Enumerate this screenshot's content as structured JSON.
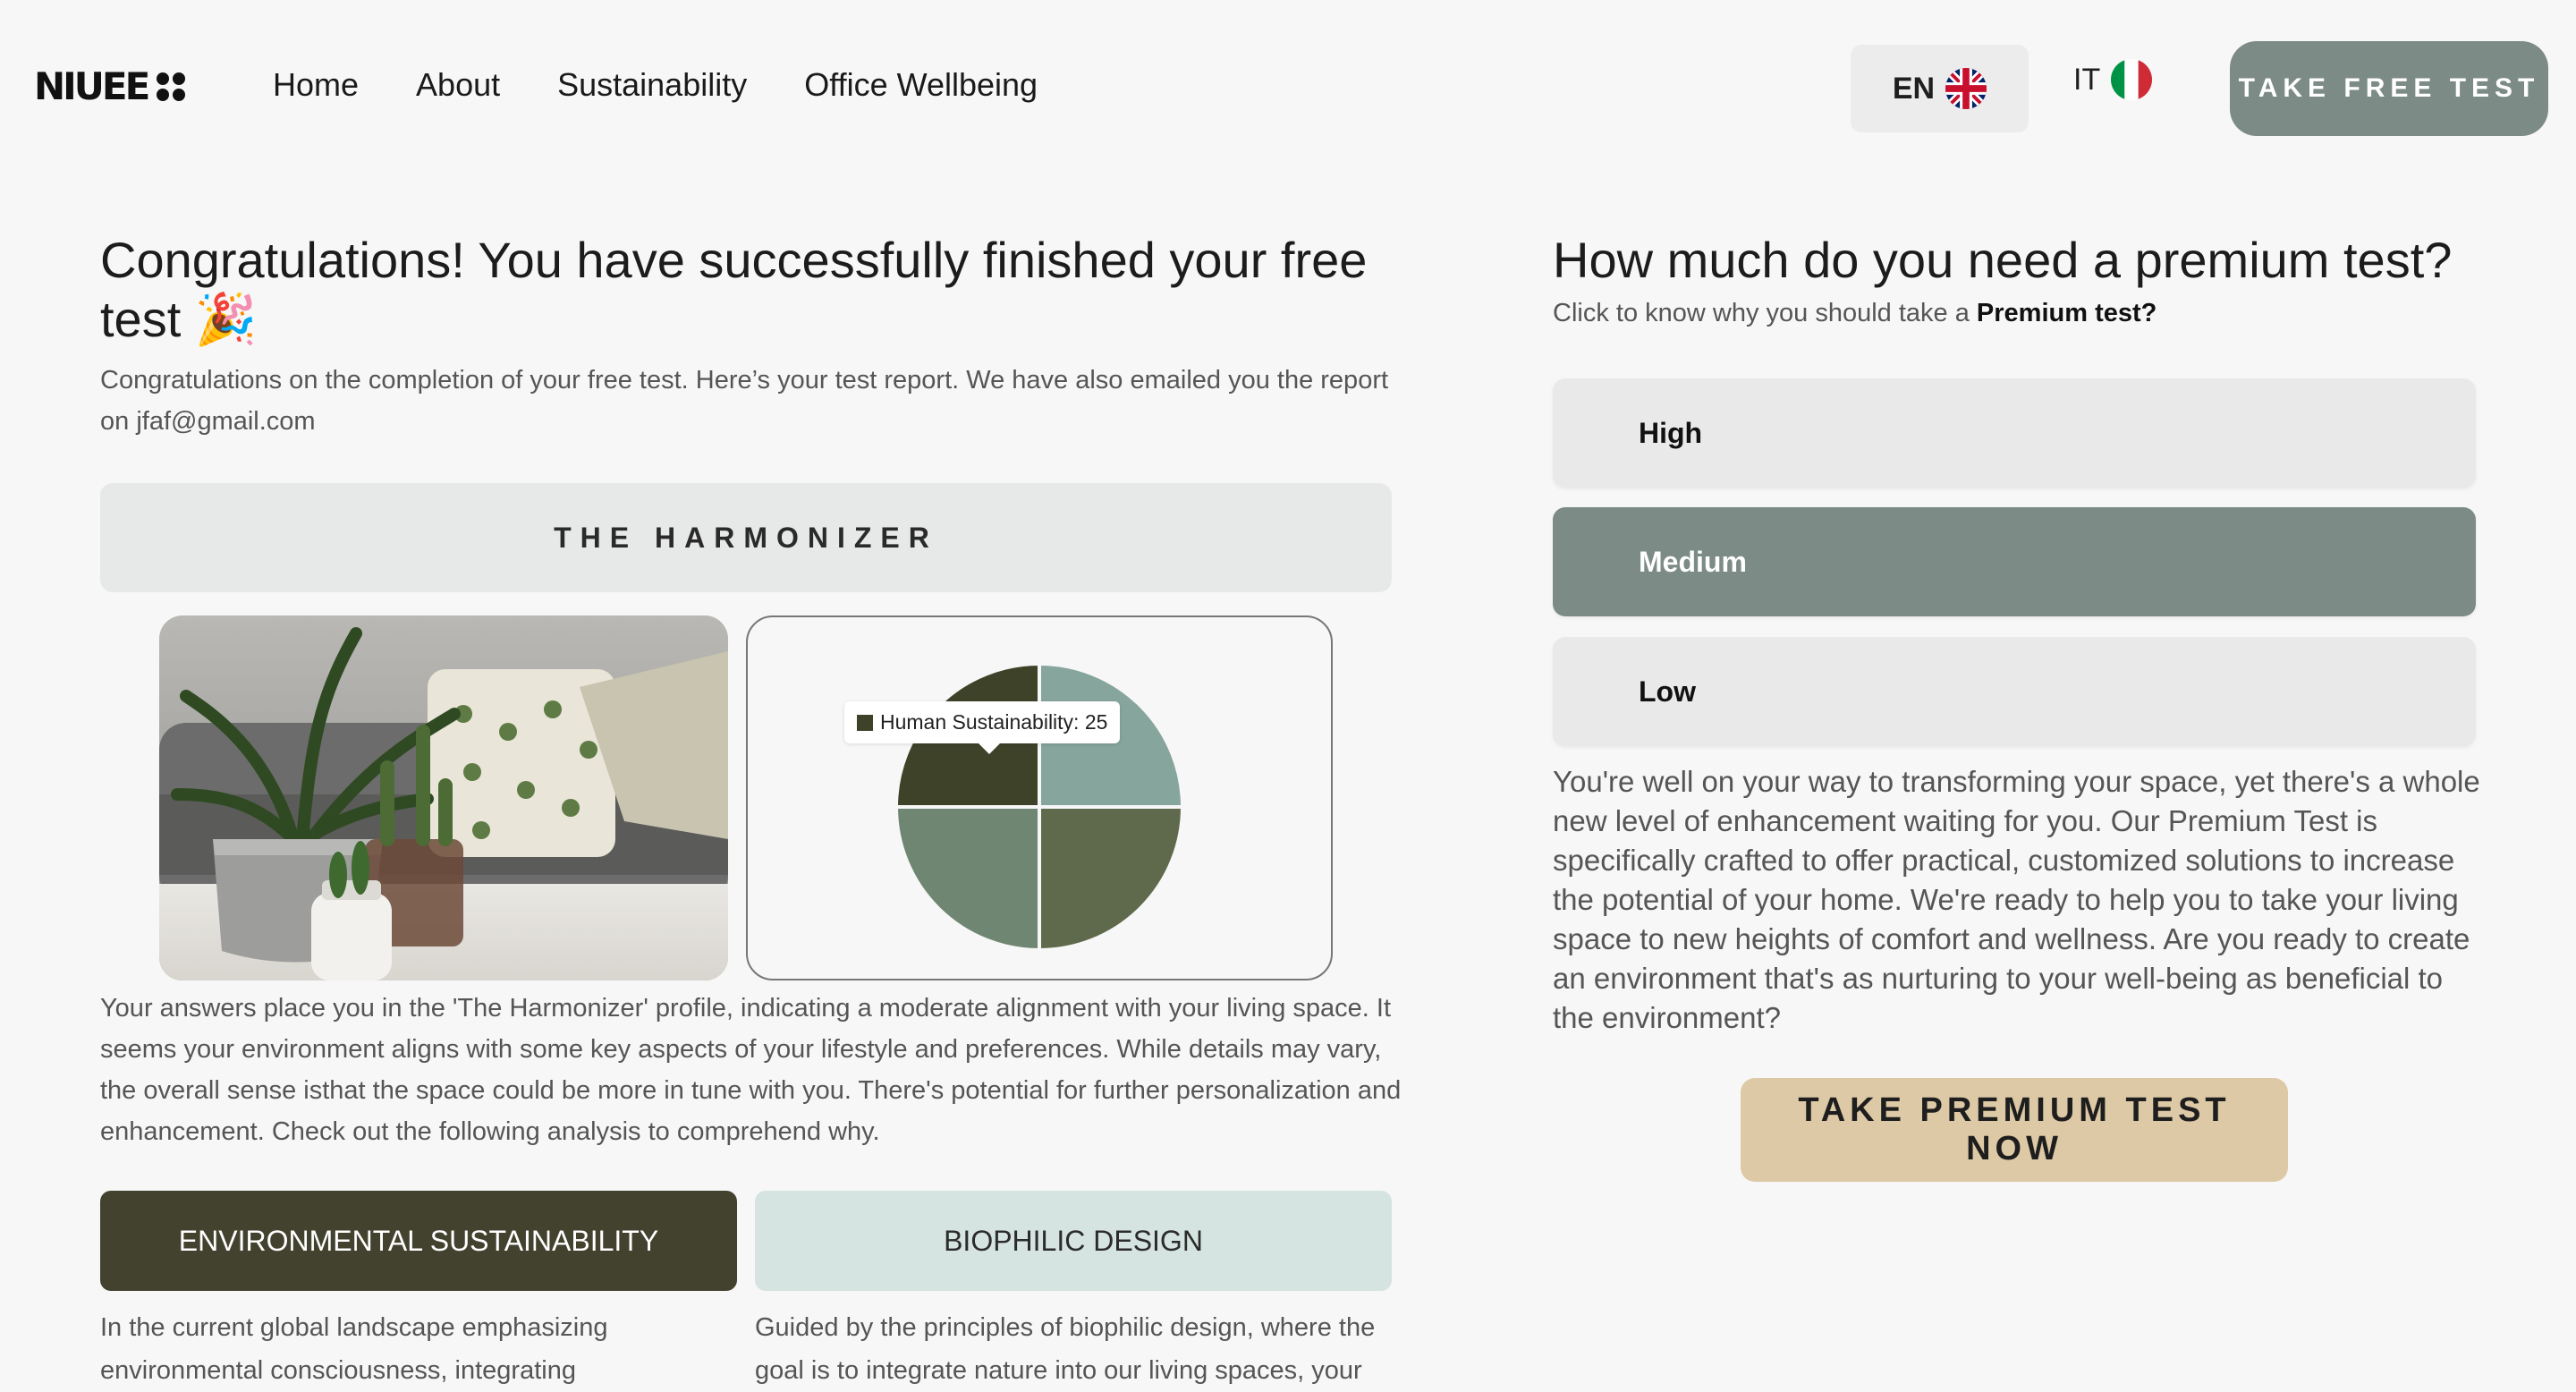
{
  "header": {
    "logo_text": "NIUEE",
    "nav": [
      "Home",
      "About",
      "Sustainability",
      "Office Wellbeing"
    ],
    "lang_en": "EN",
    "lang_it": "IT",
    "cta": "TAKE FREE TEST"
  },
  "result": {
    "title": "Congratulations! You have successfully finished your free test 🎉",
    "subtitle": "Congratulations on the completion of your free test. Here’s your test report. We have also emailed you the report on jfaf@gmail.com",
    "profile_name": "THE HARMONIZER",
    "tooltip": "Human Sustainability: 25",
    "description": "Your answers place you in the 'The Harmonizer' profile, indicating a moderate alignment with your living space. It seems your environment aligns with some key aspects of your lifestyle and preferences. While details may vary, the overall sense isthat the space could be more in tune with you. There's potential for further personalization and enhancement. Check out the following analysis to comprehend why.",
    "categories": [
      {
        "label": "ENVIRONMENTAL SUSTAINABILITY",
        "text": "In the current global landscape emphasizing environmental consciousness, integrating"
      },
      {
        "label": "BIOPHILIC DESIGN",
        "text": "Guided by the principles of biophilic design, where the goal is to integrate nature into our living spaces, your"
      }
    ]
  },
  "premium": {
    "title": "How much do you need a premium test?",
    "sub_prefix": "Click to know why you should take a ",
    "sub_bold": "Premium test?",
    "options": [
      "High",
      "Medium",
      "Low"
    ],
    "selected": "Medium",
    "description": "You're well on your way to transforming your space, yet there's a whole new level of enhancement waiting for you. Our Premium Test is specifically crafted to offer practical, customized solutions to increase the potential of your home. We're ready to help you to take your living space to new heights of comfort and wellness. Are you ready to create an environment that's as nurturing to your well-being as beneficial to the environment?",
    "cta": "TAKE PREMIUM TEST NOW"
  },
  "chart_data": {
    "type": "pie",
    "slices": [
      {
        "name": "Human Sustainability",
        "value": 25,
        "color": "#3e4229"
      },
      {
        "value": 25,
        "color": "#86a59c"
      },
      {
        "value": 25,
        "color": "#5f6a4d"
      },
      {
        "value": 25,
        "color": "#6f8672"
      }
    ]
  },
  "colors": {
    "accent": "#7c8b85",
    "dark_olive": "#43422f",
    "mint": "#d5e4e0",
    "sand": "#ddc9a5"
  }
}
